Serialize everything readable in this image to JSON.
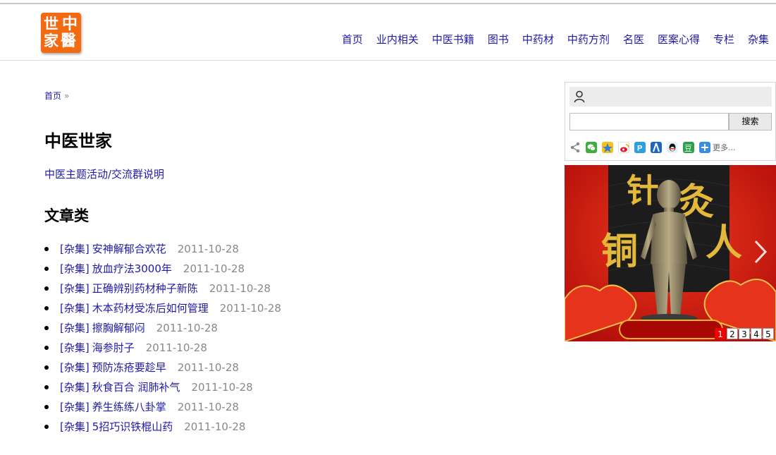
{
  "logo": {
    "chars": [
      "中",
      "世",
      "家",
      "醫"
    ]
  },
  "nav": [
    {
      "label": "首页"
    },
    {
      "label": "业内相关"
    },
    {
      "label": "中医书籍"
    },
    {
      "label": "图书"
    },
    {
      "label": "中药材"
    },
    {
      "label": "中药方剂"
    },
    {
      "label": "名医"
    },
    {
      "label": "医案心得"
    },
    {
      "label": "专栏"
    },
    {
      "label": "杂集"
    }
  ],
  "breadcrumb": {
    "home": "首页",
    "sep": "»"
  },
  "site_title": "中医世家",
  "group_link": "中医主题活动/交流群说明",
  "section_title": "文章类",
  "articles": [
    {
      "tag": "[杂集]",
      "title": "安神解郁合欢花",
      "date": "2011-10-28"
    },
    {
      "tag": "[杂集]",
      "title": "放血疗法3000年",
      "date": "2011-10-28"
    },
    {
      "tag": "[杂集]",
      "title": "正确辨别药材种子新陈",
      "date": "2011-10-28"
    },
    {
      "tag": "[杂集]",
      "title": "木本药材受冻后如何管理",
      "date": "2011-10-28"
    },
    {
      "tag": "[杂集]",
      "title": "擦胸解郁闷",
      "date": "2011-10-28"
    },
    {
      "tag": "[杂集]",
      "title": "海参肘子",
      "date": "2011-10-28"
    },
    {
      "tag": "[杂集]",
      "title": "预防冻疮要趁早",
      "date": "2011-10-28"
    },
    {
      "tag": "[杂集]",
      "title": "秋食百合 润肺补气",
      "date": "2011-10-28"
    },
    {
      "tag": "[杂集]",
      "title": "养生练练八卦掌",
      "date": "2011-10-28"
    },
    {
      "tag": "[杂集]",
      "title": "5招巧识铁棍山药",
      "date": "2011-10-28"
    }
  ],
  "search": {
    "button_label": "搜索",
    "value": ""
  },
  "share": {
    "icons": [
      "wechat-icon",
      "qzone-icon",
      "weibo-icon",
      "pengyou-icon",
      "renren-icon",
      "qq-icon",
      "douban-icon",
      "more-plus-icon"
    ],
    "more_label": "更多..."
  },
  "banner": {
    "calligraphy": [
      "针",
      "灸",
      "铜",
      "人"
    ],
    "pages": [
      "1",
      "2",
      "3",
      "4",
      "5"
    ],
    "active_page": "1"
  },
  "colors": {
    "link": "#1f1aa8",
    "logo_bg": "#f26a12",
    "banner_red": "#c8140f",
    "date_gray": "#888888"
  }
}
